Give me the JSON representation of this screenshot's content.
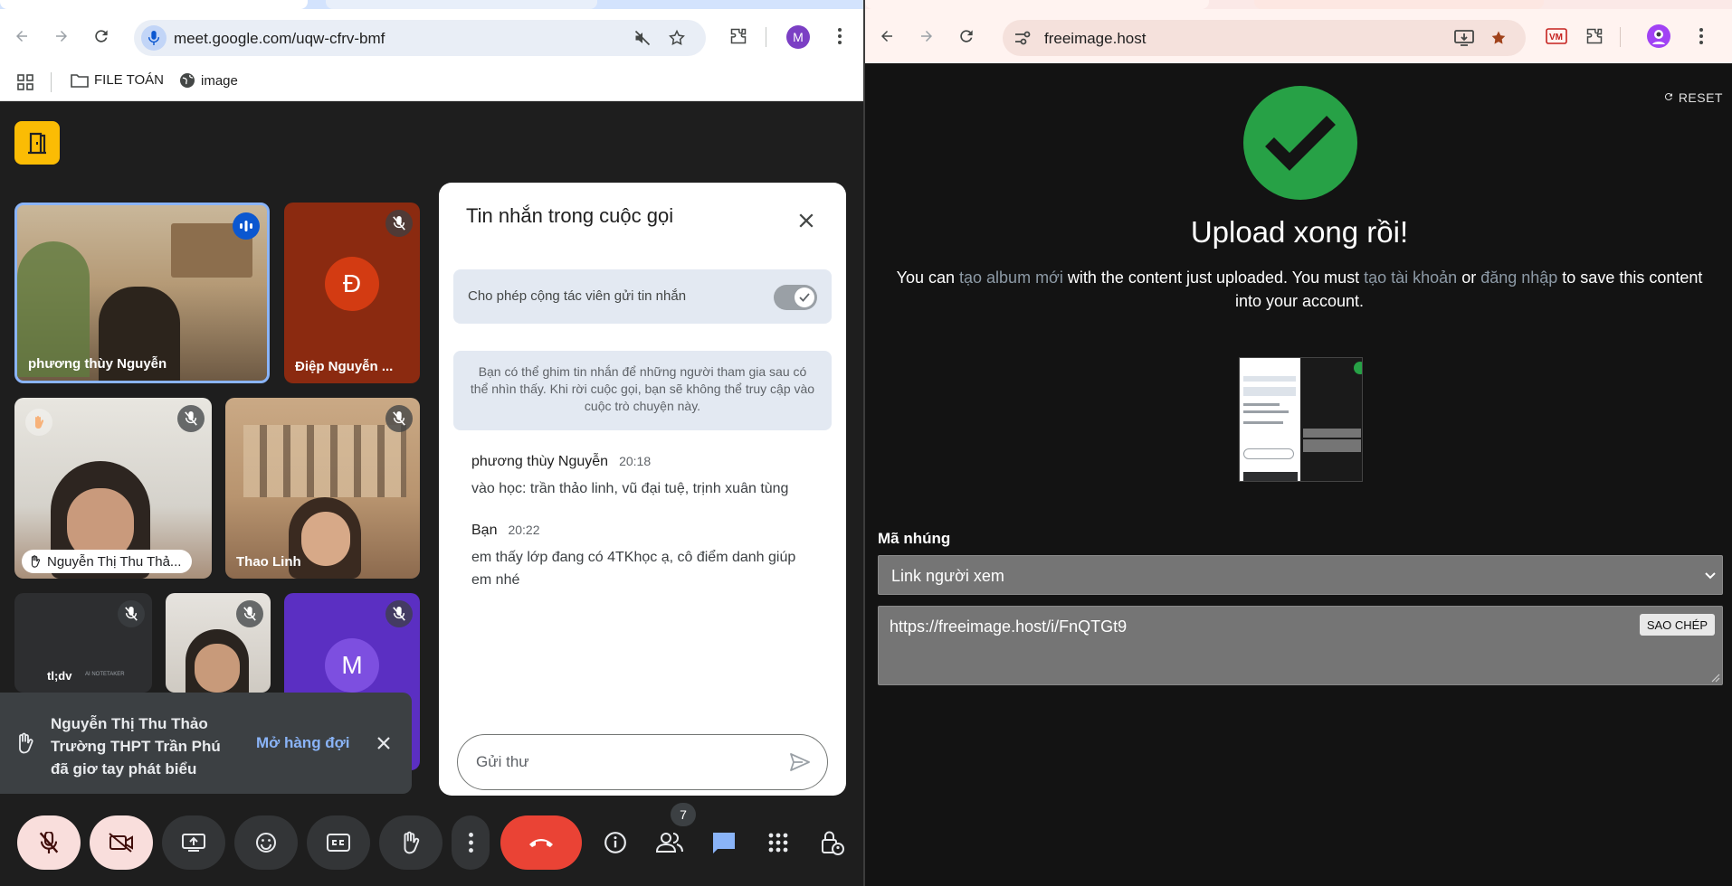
{
  "left_browser": {
    "url": "meet.google.com/uqw-cfrv-bmf",
    "profile_initial": "M",
    "bookmarks": [
      {
        "label": "FILE TOÁN",
        "icon": "folder-icon"
      },
      {
        "label": "image",
        "icon": "globe-icon"
      }
    ]
  },
  "meet": {
    "participants": [
      {
        "name": "phương thùy Nguyễn",
        "state": "speaking"
      },
      {
        "name": "Điệp Nguyễn ...",
        "initial": "Đ",
        "state": "muted"
      },
      {
        "name": "Nguyễn Thị Thu Thả...",
        "state": "muted, hand raised"
      },
      {
        "name": "Thao Linh",
        "state": "muted"
      },
      {
        "name": "tl;dv",
        "state": "muted"
      },
      {
        "name": "",
        "state": "muted"
      },
      {
        "name": "",
        "initial": "M",
        "state": "muted"
      }
    ],
    "tldv_tag": "AI NOTETAKER",
    "toast": {
      "line1": "Nguyễn Thị Thu Thảo",
      "line2": "Trường THPT Trần Phú",
      "line3": "đã giơ tay phát biểu",
      "action": "Mở hàng đợi"
    },
    "chat": {
      "title": "Tin nhắn trong cuộc gọi",
      "toggle_label": "Cho phép cộng tác viên gửi tin nhắn",
      "toggle_on": true,
      "info": "Bạn có thể ghim tin nhắn để những người tham gia sau có thể nhìn thấy. Khi rời cuộc gọi, bạn sẽ không thể truy cập vào cuộc trò chuyện này.",
      "messages": [
        {
          "sender": "phương thùy Nguyễn",
          "time": "20:18",
          "text": "vào học: trần thảo linh, vũ đại tuệ, trịnh xuân tùng"
        },
        {
          "sender": "Bạn",
          "time": "20:22",
          "text": "em thấy lớp đang có 4TKhọc ạ, cô điểm danh giúp em nhé"
        }
      ],
      "input_placeholder": "Gửi thư"
    },
    "participant_count": "7",
    "colors": {
      "accent_yellow": "#fbbc04",
      "end_call": "#ea4335",
      "blue_link": "#8ab4f8"
    }
  },
  "right_browser": {
    "url": "freeimage.host"
  },
  "freeimage": {
    "reset": "RESET",
    "title": "Upload xong rồi!",
    "desc_1": "You can ",
    "link_album": "tạo album mới",
    "desc_2": " with the content just uploaded. You must ",
    "link_account": "tạo tài khoản",
    "desc_3": " or ",
    "link_login": "đăng nhập",
    "desc_4": " to save this content into your account.",
    "embed_label": "Mã nhúng",
    "embed_select": "Link người xem",
    "embed_value": "https://freeimage.host/i/FnQTGt9",
    "copy_button": "SAO CHÉP",
    "colors": {
      "success_green": "#27a146"
    }
  }
}
